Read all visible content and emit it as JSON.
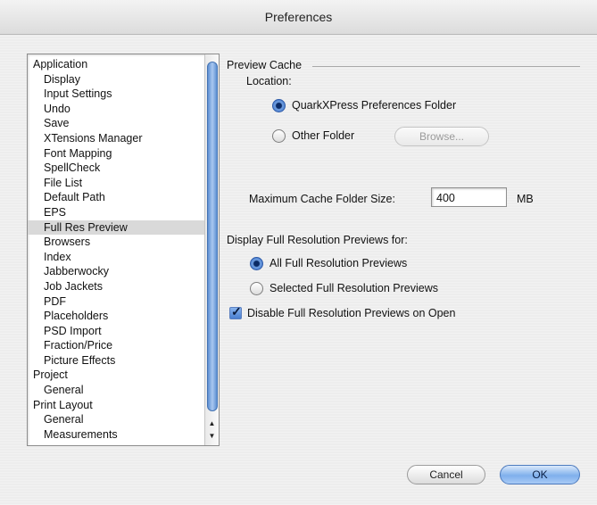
{
  "window": {
    "title": "Preferences"
  },
  "categories": [
    {
      "label": "Application",
      "level": 0
    },
    {
      "label": "Display",
      "level": 1
    },
    {
      "label": "Input Settings",
      "level": 1
    },
    {
      "label": "Undo",
      "level": 1
    },
    {
      "label": "Save",
      "level": 1
    },
    {
      "label": "XTensions Manager",
      "level": 1
    },
    {
      "label": "Font Mapping",
      "level": 1
    },
    {
      "label": "SpellCheck",
      "level": 1
    },
    {
      "label": "File List",
      "level": 1
    },
    {
      "label": "Default Path",
      "level": 1
    },
    {
      "label": "EPS",
      "level": 1
    },
    {
      "label": "Full Res Preview",
      "level": 1,
      "selected": true
    },
    {
      "label": "Browsers",
      "level": 1
    },
    {
      "label": "Index",
      "level": 1
    },
    {
      "label": "Jabberwocky",
      "level": 1
    },
    {
      "label": "Job Jackets",
      "level": 1
    },
    {
      "label": "PDF",
      "level": 1
    },
    {
      "label": "Placeholders",
      "level": 1
    },
    {
      "label": "PSD Import",
      "level": 1
    },
    {
      "label": "Fraction/Price",
      "level": 1
    },
    {
      "label": "Picture Effects",
      "level": 1
    },
    {
      "label": "Project",
      "level": 0
    },
    {
      "label": "General",
      "level": 1
    },
    {
      "label": "Print Layout",
      "level": 0
    },
    {
      "label": "General",
      "level": 1
    },
    {
      "label": "Measurements",
      "level": 1
    }
  ],
  "preview_cache": {
    "group_label": "Preview Cache",
    "location_label": "Location:",
    "options": {
      "quark_folder": "QuarkXPress Preferences Folder",
      "other_folder": "Other Folder"
    },
    "selected_location": "quark_folder",
    "browse_label": "Browse...",
    "max_size_label": "Maximum Cache Folder Size:",
    "max_size_value": "400",
    "max_size_unit": "MB"
  },
  "display_previews": {
    "label": "Display Full Resolution Previews for:",
    "options": {
      "all": "All Full Resolution Previews",
      "selected": "Selected Full Resolution Previews"
    },
    "selected_option": "all"
  },
  "disable_on_open": {
    "label": "Disable Full Resolution Previews on Open",
    "checked": true
  },
  "buttons": {
    "cancel": "Cancel",
    "ok": "OK"
  }
}
